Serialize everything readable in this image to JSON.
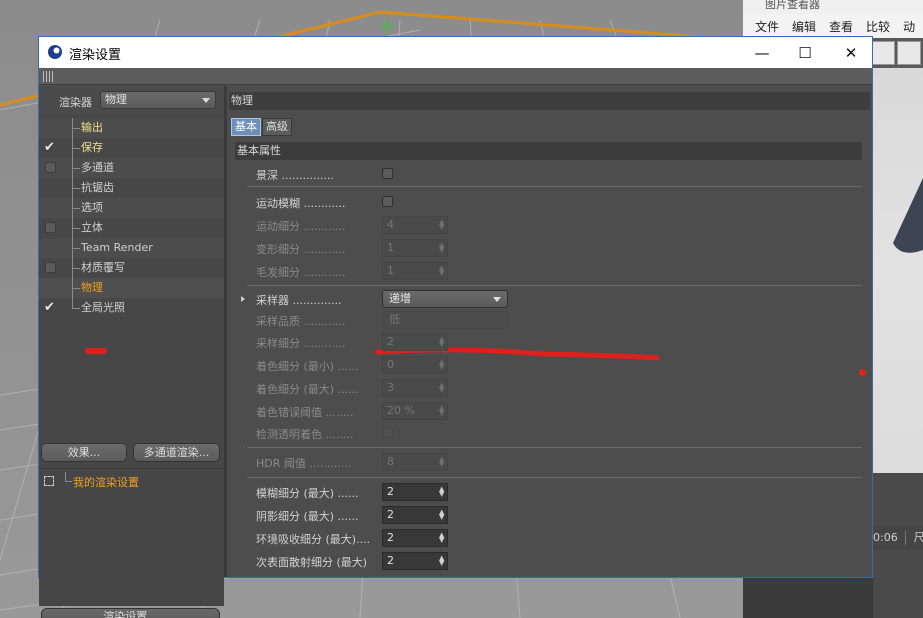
{
  "dialog": {
    "title": "渲染设置",
    "minimize_symbol": "—",
    "maximize_symbol": "☐",
    "close_symbol": "✕"
  },
  "left_panel": {
    "renderer_label": "渲染器",
    "renderer_value": "物理",
    "settings": [
      {
        "label": "输出",
        "checked": false,
        "has_checkbox": false,
        "style": "highlight"
      },
      {
        "label": "保存",
        "checked": true,
        "has_checkbox": true,
        "style": "highlight"
      },
      {
        "label": "多通道",
        "checked": false,
        "has_checkbox": true,
        "style": "normal"
      },
      {
        "label": "抗锯齿",
        "checked": false,
        "has_checkbox": false,
        "style": "normal"
      },
      {
        "label": "选项",
        "checked": false,
        "has_checkbox": false,
        "style": "normal"
      },
      {
        "label": "立体",
        "checked": false,
        "has_checkbox": true,
        "style": "normal"
      },
      {
        "label": "Team Render",
        "checked": false,
        "has_checkbox": false,
        "style": "normal"
      },
      {
        "label": "材质覆写",
        "checked": false,
        "has_checkbox": true,
        "style": "normal"
      },
      {
        "label": "物理",
        "checked": false,
        "has_checkbox": false,
        "style": "active"
      },
      {
        "label": "全局光照",
        "checked": true,
        "has_checkbox": true,
        "style": "normal"
      }
    ],
    "effects_button": "效果...",
    "multipass_button": "多通道渲染...",
    "preset_label": "我的渲染设置",
    "render_settings_button": "渲染设置..."
  },
  "right_panel": {
    "header": "物理",
    "tabs": [
      {
        "label": "基本",
        "active": true
      },
      {
        "label": "高级",
        "active": false
      }
    ],
    "section_title": "基本属性",
    "depth_of_field": {
      "label": "景深",
      "dots": " ..............."
    },
    "motion_blur": {
      "label": "运动模糊",
      "dots": " ............"
    },
    "motion_subdiv": {
      "label": "运动细分",
      "dots": " ............",
      "value": "4"
    },
    "deform_subdiv": {
      "label": "变形细分",
      "dots": " ............",
      "value": "1"
    },
    "hair_subdiv": {
      "label": "毛发细分",
      "dots": " ............",
      "value": "1"
    },
    "sampler": {
      "label": "采样器",
      "dots": " ..............",
      "value": "递增"
    },
    "sampling_quality": {
      "label": "采样品质",
      "dots": " ............",
      "value": "低"
    },
    "sampling_subdiv": {
      "label": "采样细分",
      "dots": " ............",
      "value": "2"
    },
    "shading_subdiv_min": {
      "label": "着色细分 (最小)",
      "dots": " ......",
      "value": "0"
    },
    "shading_subdiv_max": {
      "label": "着色细分 (最大)",
      "dots": " ......",
      "value": "3"
    },
    "shading_error": {
      "label": "着色错误阈值",
      "dots": " ........",
      "value": "20 %"
    },
    "detect_transparent": {
      "label": "检测透明着色",
      "dots": " ........"
    },
    "hdr_threshold": {
      "label": "HDR 阈值",
      "dots": " ............",
      "value": "8"
    },
    "blur_subdiv_max": {
      "label": "模糊细分 (最大)",
      "dots": " ......",
      "value": "2"
    },
    "shadow_subdiv_max": {
      "label": "阴影细分 (最大)",
      "dots": " ......",
      "value": "2"
    },
    "ao_subdiv_max": {
      "label": "环境吸收细分 (最大)",
      "dots": "....",
      "value": "2"
    },
    "sss_subdiv_max": {
      "label": "次表面散射细分 (最大)",
      "dots": "",
      "value": "2"
    }
  },
  "picture_viewer": {
    "title": "图片查看器",
    "menu": [
      "文件",
      "编辑",
      "查看",
      "比较",
      "动"
    ],
    "status_time": "0:06",
    "status_size": "尺寸"
  },
  "colors": {
    "active_item": "#f0a020",
    "highlight_item": "#f0e08a",
    "annotation_red": "#e0201c",
    "tab_active": "#6f8fb8"
  }
}
